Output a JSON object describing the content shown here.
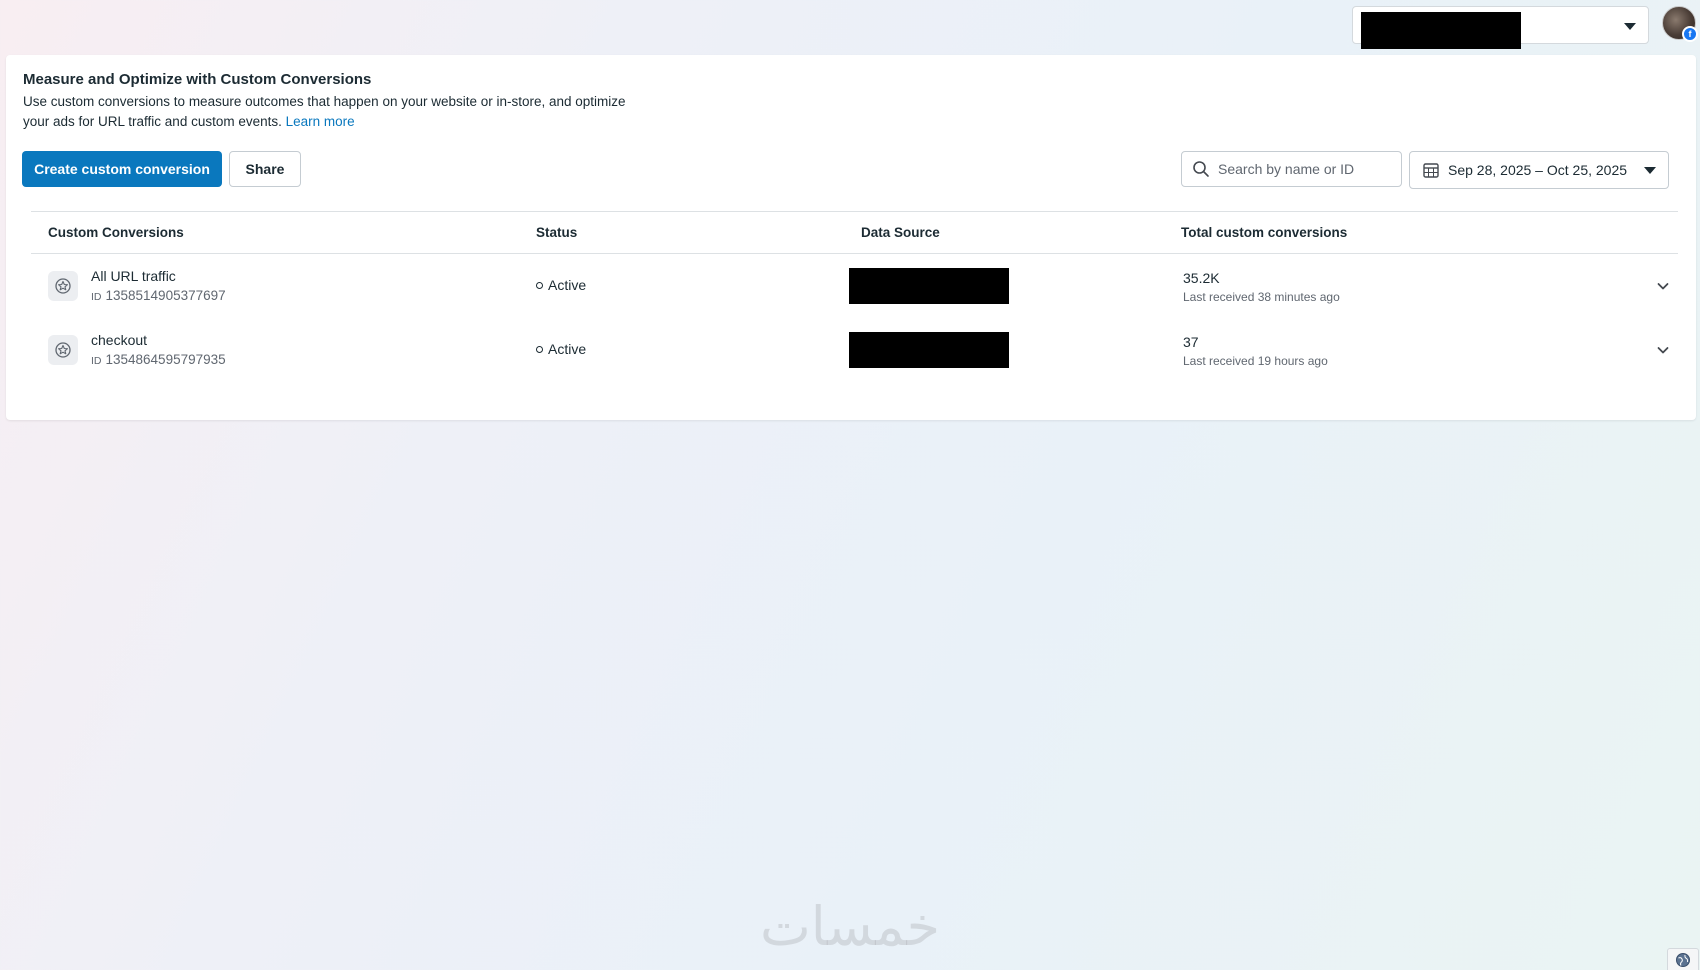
{
  "header": {
    "account_name": "",
    "avatar_alt": ""
  },
  "page": {
    "title": "Measure and Optimize with Custom Conversions",
    "description": "Use custom conversions to measure outcomes that happen on your website or in-store, and optimize your ads for URL traffic and custom events.",
    "learn_more": "Learn more"
  },
  "toolbar": {
    "create_label": "Create custom conversion",
    "share_label": "Share",
    "search_placeholder": "Search by name or ID",
    "date_range": "Sep 28, 2025 – Oct 25, 2025"
  },
  "table": {
    "columns": [
      "Custom Conversions",
      "Status",
      "Data Source",
      "Total custom conversions"
    ],
    "rows": [
      {
        "name": "All URL traffic",
        "id_prefix": "ID",
        "id": "1358514905377697",
        "status": "Active",
        "total": "35.2K",
        "last_received": "Last received 38 minutes ago"
      },
      {
        "name": "checkout",
        "id_prefix": "ID",
        "id": "1354864595797935",
        "status": "Active",
        "total": "37",
        "last_received": "Last received 19 hours ago"
      }
    ]
  },
  "footer": {
    "watermark": "خمسات"
  },
  "colors": {
    "primary": "#0a78be",
    "text": "#1c2b33",
    "muted": "#606770",
    "border": "#c5ccd2"
  },
  "icons": {
    "search": "search-icon",
    "calendar": "calendar-icon",
    "caret": "caret-down-icon",
    "row": "conversion-star-icon",
    "expand": "chevron-down-icon",
    "globe": "globe-icon"
  }
}
